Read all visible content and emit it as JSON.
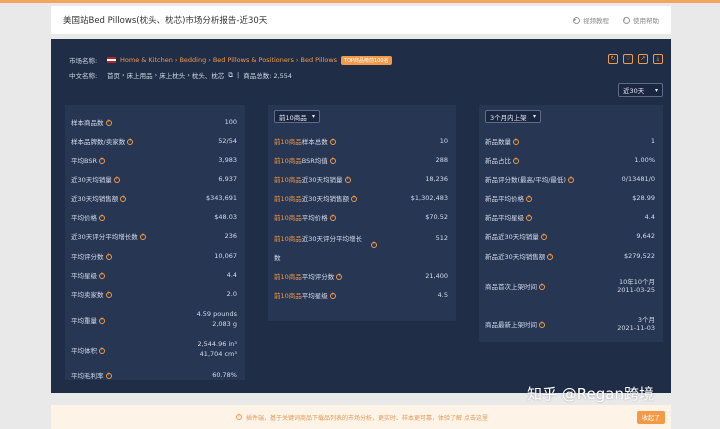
{
  "header": {
    "title": "美国站Bed Pillows(枕头、枕芯)市场分析报告-近30天",
    "link_video": "视频教程",
    "link_help": "使用帮助"
  },
  "meta": {
    "market_label": "市场名称:",
    "breadcrumb": [
      "Home & Kitchen",
      "Bedding",
      "Bed Pillows & Positioners",
      "Bed Pillows"
    ],
    "badge": "TOP商品榜前100名",
    "cn_label": "中文名称:",
    "cn_breadcrumb": [
      "首页",
      "床上用品",
      "床上枕头",
      "枕头、枕芯"
    ],
    "total_label": "商品总数: 2,554"
  },
  "period_select": "近30天",
  "col2_select": "前10商品",
  "col3_select": "3个月内上架",
  "col1": [
    {
      "k": "样本商品数",
      "v": "100"
    },
    {
      "k": "样本品牌数/卖家数",
      "v": "52/54"
    },
    {
      "k": "平均BSR",
      "v": "3,983"
    },
    {
      "k": "近30天均销量",
      "v": "6,937"
    },
    {
      "k": "近30天均销售额",
      "v": "$343,691"
    },
    {
      "k": "平均价格",
      "v": "$48.03"
    },
    {
      "k": "近30天评分平均增长数",
      "v": "236"
    },
    {
      "k": "平均评分数",
      "v": "10,067"
    },
    {
      "k": "平均星级",
      "v": "4.4"
    },
    {
      "k": "平均卖家数",
      "v": "2.0"
    },
    {
      "k": "平均重量",
      "v": "4.59 pounds",
      "v2": "2,083 g"
    },
    {
      "k": "平均体积",
      "v": "2,544.96 in³",
      "v2": "41,704 cm³"
    },
    {
      "k": "平均毛利率",
      "v": "60.78%"
    }
  ],
  "col2": [
    {
      "hl": "前10商品",
      "k": "样本总数",
      "v": "10"
    },
    {
      "hl": "前10商品",
      "k": "BSR均值",
      "v": "288"
    },
    {
      "hl": "前10商品",
      "k": "近30天均销量",
      "v": "18,236"
    },
    {
      "hl": "前10商品",
      "k": "近30天均销售额",
      "v": "$1,302,483"
    },
    {
      "hl": "前10商品",
      "k": "平均价格",
      "v": "$70.52"
    },
    {
      "hl": "前10商品",
      "k": "近30天评分平均增长",
      "k2": "数",
      "v": "512"
    },
    {
      "hl": "前10商品",
      "k": "平均评分数",
      "v": "21,400"
    },
    {
      "hl": "前10商品",
      "k": "平均星级",
      "v": "4.5"
    }
  ],
  "col3": [
    {
      "k": "新品数量",
      "v": "1"
    },
    {
      "k": "新品占比",
      "v": "1.00%"
    },
    {
      "k": "新品评分数(最高/平均/最低)",
      "v": "0/13481/0"
    },
    {
      "k": "新品平均价格",
      "v": "$28.99"
    },
    {
      "k": "新品平均星级",
      "v": "4.4"
    },
    {
      "k": "新品近30天均销量",
      "v": "9,642"
    },
    {
      "k": "新品近30天均销售额",
      "v": "$279,522"
    },
    {
      "k": "商品首次上架时间",
      "v": "10年10个月",
      "v2": "2011-03-25"
    },
    {
      "k": "商品最新上架时间",
      "v": "3个月",
      "v2": "2021-11-03"
    }
  ],
  "bottombar": {
    "text": "插件端，基于关键词商品下载品列表的市场分析，更实时、样本更可靠，体验了解 点击这里",
    "expand": "收起了"
  },
  "watermark": "知乎 @Regan跨境",
  "colors": {
    "accent": "#f39a48",
    "panel": "#1f2d47",
    "card": "#263653"
  }
}
